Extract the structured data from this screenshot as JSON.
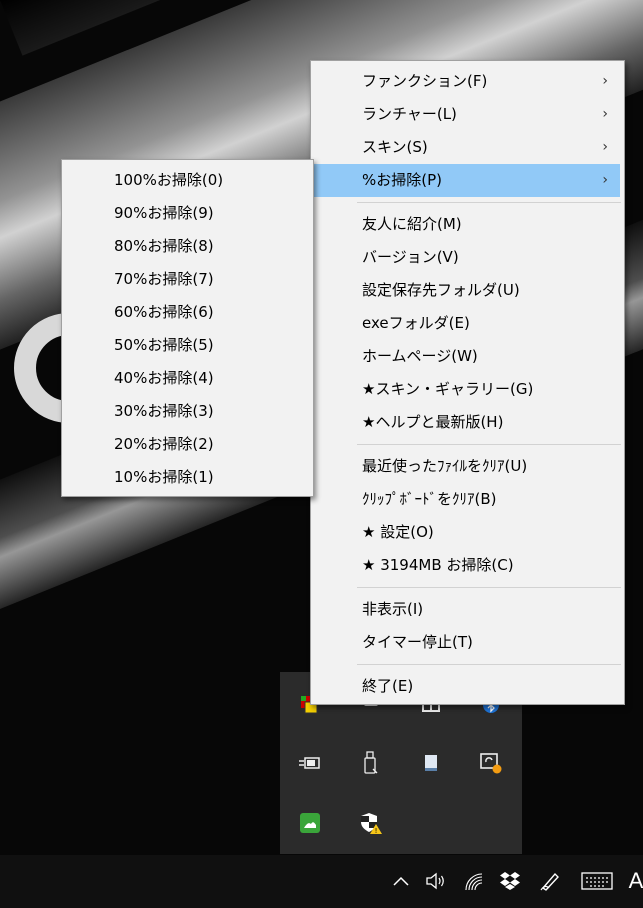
{
  "main_menu": {
    "items": [
      {
        "label": "ファンクション(F)",
        "submenu": true
      },
      {
        "label": "ランチャー(L)",
        "submenu": true
      },
      {
        "label": "スキン(S)",
        "submenu": true
      },
      {
        "label": "%お掃除(P)",
        "submenu": true,
        "highlighted": true
      },
      {
        "label": "友人に紹介(M)"
      },
      {
        "label": "バージョン(V)"
      },
      {
        "label": "設定保存先フォルダ(U)"
      },
      {
        "label": "exeフォルダ(E)"
      },
      {
        "label": "ホームページ(W)"
      },
      {
        "label": "★スキン・ギャラリー(G)"
      },
      {
        "label": "★ヘルプと最新版(H)"
      },
      {
        "label": "最近使ったﾌｧｲﾙをｸﾘｱ(U)"
      },
      {
        "label": "ｸﾘｯﾌﾟﾎﾞｰﾄﾞをｸﾘｱ(B)"
      },
      {
        "label": "★ 設定(O)"
      },
      {
        "label": "★ 3194MB お掃除(C)"
      },
      {
        "label": "非表示(I)"
      },
      {
        "label": "タイマー停止(T)"
      },
      {
        "label": "終了(E)"
      }
    ],
    "arrow_glyph": "›"
  },
  "sub_menu": {
    "items": [
      {
        "label": "100%お掃除(0)"
      },
      {
        "label": "90%お掃除(9)"
      },
      {
        "label": "80%お掃除(8)"
      },
      {
        "label": "70%お掃除(7)"
      },
      {
        "label": "60%お掃除(6)"
      },
      {
        "label": "50%お掃除(5)"
      },
      {
        "label": "40%お掃除(4)"
      },
      {
        "label": "30%お掃除(3)"
      },
      {
        "label": "20%お掃除(2)"
      },
      {
        "label": "10%お掃除(1)"
      }
    ]
  },
  "colors": {
    "highlight": "#91c9f7",
    "menu_bg": "#f2f2f2",
    "taskbar_bg": "#101010",
    "tray_bg": "#2b2b2b"
  },
  "tray_icons": [
    "app-tray-icon",
    "usb-icon",
    "window-icon",
    "bluetooth-icon",
    "power-icon",
    "usb-drive-icon",
    "monitor-icon",
    "remote-sync-icon",
    "green-app-icon",
    "shield-warning-icon"
  ],
  "taskbar_icons": [
    "chevron-up-icon",
    "volume-icon",
    "wifi-icon",
    "dropbox-icon",
    "pen-icon",
    "keyboard-icon"
  ],
  "taskbar": {
    "ime_label": "A"
  }
}
